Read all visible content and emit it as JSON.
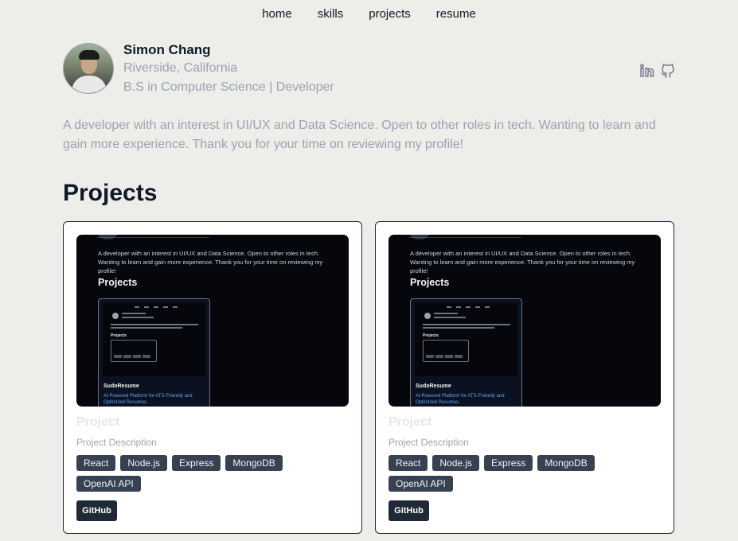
{
  "nav": {
    "items": [
      "home",
      "skills",
      "projects",
      "resume"
    ]
  },
  "profile": {
    "name": "Simon Chang",
    "location": "Riverside, California",
    "title": "B.S in Computer Science | Developer",
    "social": [
      "linkedin-icon",
      "github-icon"
    ]
  },
  "bio": "A developer with an interest in UI/UX and Data Science. Open to other roles in tech. Wanting to learn and gain more experience. Thank you for your time on reviewing my profile!",
  "projects_heading": "Projects",
  "preview": {
    "bio": "A developer with an interest in UI/UX and Data Science. Open to other roles in tech. Wanting to learn and gain more experience. Thank you for your time on reviewing my profile!",
    "heading": "Projects",
    "inner_title": "SudoResume",
    "inner_desc": "AI-Powered Platform for ATS-Friendly and Optimized Resumes."
  },
  "cards": [
    {
      "title": "Project",
      "description": "Project Description",
      "tags": [
        "React",
        "Node.js",
        "Express",
        "MongoDB",
        "OpenAI API"
      ],
      "button": "GitHub"
    },
    {
      "title": "Project",
      "description": "Project Description",
      "tags": [
        "React",
        "Node.js",
        "Express",
        "MongoDB",
        "OpenAI API"
      ],
      "button": "GitHub"
    }
  ],
  "colors": {
    "background": "#ededea",
    "card_border": "#1f2937",
    "tag_bg": "#374151",
    "muted_text": "#9ca3af"
  }
}
